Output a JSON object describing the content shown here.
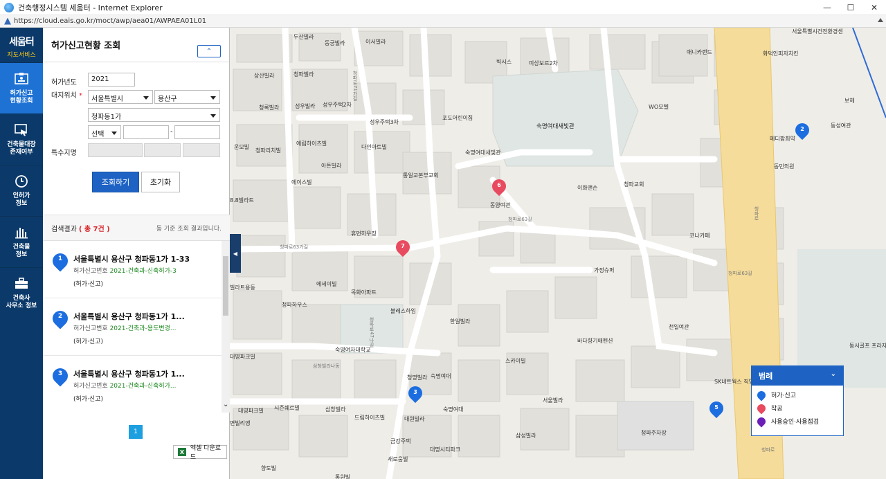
{
  "window": {
    "title": "건축행정시스템 세움터 - Internet Explorer",
    "url": "https://cloud.eais.go.kr/moct/awp/aea01/AWPAEA01L01"
  },
  "brand": {
    "name": "세움터",
    "sub": "지도서비스"
  },
  "nav": [
    {
      "label": "허가신고\n현황조회",
      "icon": "permit-report-icon",
      "active": true
    },
    {
      "label": "건축물대장\n존재여부",
      "icon": "building-register-icon",
      "active": false
    },
    {
      "label": "인허가\n정보",
      "icon": "clock-icon",
      "active": false
    },
    {
      "label": "건축물\n정보",
      "icon": "bar-chart-icon",
      "active": false
    },
    {
      "label": "건축사\n사무소 정보",
      "icon": "briefcase-icon",
      "active": false
    }
  ],
  "panel": {
    "title": "허가신고현황 조회",
    "form": {
      "year_label": "허가년도",
      "year_value": "2021",
      "location_label": "대지위치",
      "city": "서울특별시",
      "district": "용산구",
      "dong": "청파동1가",
      "lot_type": "선택",
      "lot_sep": "-",
      "special_label": "특수지명"
    },
    "search_button": "조회하기",
    "reset_button": "초기화",
    "result_label": "검색결과",
    "result_count": "( 총 7건 )",
    "result_note": "동 기준 조회 결과입니다.",
    "results": [
      {
        "num": "1",
        "address": "서울특별시 용산구 청파동1가 1-33",
        "permit_prefix": "허가신고번호",
        "permit_no": "2021-건축과-신축허가-3",
        "type": "(허가·신고)"
      },
      {
        "num": "2",
        "address": "서울특별시 용산구 청파동1가 1...",
        "permit_prefix": "허가신고번호",
        "permit_no": "2021-건축과-용도변경...",
        "type": "(허가·신고)"
      },
      {
        "num": "3",
        "address": "서울특별시 용산구 청파동1가 1...",
        "permit_prefix": "허가신고번호",
        "permit_no": "2021-건축과-신축허가...",
        "type": "(허가·신고)"
      }
    ],
    "page": "1",
    "excel_button": "엑셀 다운로드"
  },
  "legend": {
    "title": "범례",
    "items": [
      {
        "label": "허가·신고",
        "color": "#1c6de0"
      },
      {
        "label": "착공",
        "color": "#e84a5f"
      },
      {
        "label": "사용승인·사용점검",
        "color": "#6a1fb8"
      }
    ]
  },
  "map": {
    "pins": [
      {
        "num": "1",
        "color": "blue"
      },
      {
        "num": "2",
        "color": "blue"
      },
      {
        "num": "3",
        "color": "blue"
      },
      {
        "num": "5",
        "color": "blue"
      },
      {
        "num": "6",
        "color": "red"
      },
      {
        "num": "7",
        "color": "red"
      }
    ],
    "labels": [
      "두산빌라",
      "동궁빌라",
      "이서빌라",
      "빅시스",
      "미상보르2차",
      "애니카랜드",
      "서울특별시건전환경센",
      "화덕인피자치킨",
      "보헤",
      "동성여관",
      "메디팜최약",
      "동민의원",
      "상산빌라",
      "청파빌라",
      "청록빌라",
      "성우빌라",
      "성우주택2차",
      "성우주택3차",
      "포도어린이집",
      "숙명여대새빛관",
      "WO모텔",
      "숙명여대새빛관",
      "운모빌",
      "청파리치빌",
      "에림하이츠빌",
      "다인아트빌",
      "아튼빌라",
      "통일교본부교회",
      "이화맨손",
      "청파교회",
      "에이스빌",
      "동양여관",
      "코나카페",
      "휴먼하우징",
      "청파로63길",
      "가정슈퍼",
      "에세이빌",
      "목화아파트",
      "블레스하임",
      "청파하우스",
      "한일빌라",
      "천일여관",
      "바다향기애펜션",
      "숙명여자대학교",
      "스카이빌",
      "삼창빌라나동",
      "청명빌라",
      "숙명여대",
      "SK네트웍스 직영청파",
      "동서골프 프라자",
      "대영파크빌",
      "시즌쉐르빌",
      "삼창빌라",
      "드림하이츠빌",
      "대원빌라",
      "숙명여대",
      "서울빌라",
      "금강주택",
      "대명시티파크",
      "새로움빌",
      "삼성빌라",
      "청파주차장",
      "향토빌",
      "청파로",
      "통원빌",
      "8.8빌라트",
      "빌라트용동",
      "대명파크빌",
      "면빌리앵",
      "청파로71가길",
      "청파로47나길",
      "청파로63가길",
      "청파로",
      "청파로63길"
    ]
  }
}
